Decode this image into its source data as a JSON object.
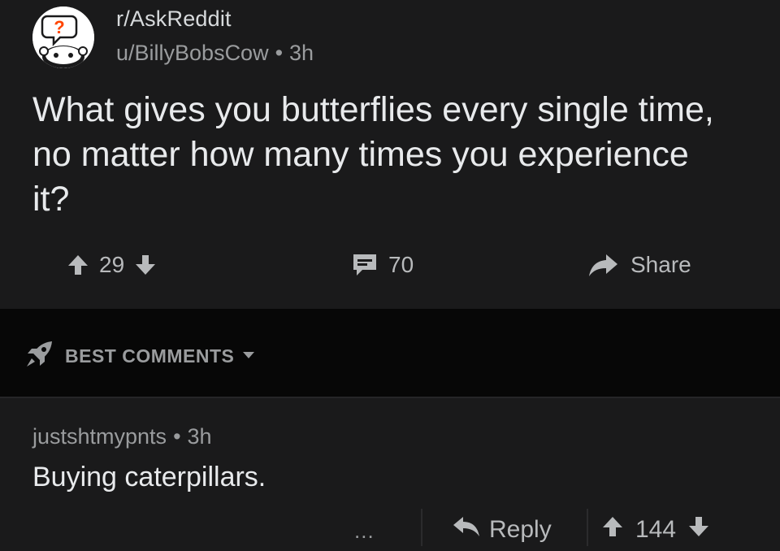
{
  "post": {
    "subreddit": "r/AskReddit",
    "author": "u/BillyBobsCow",
    "separator": "•",
    "age": "3h",
    "title": "What gives you butterflies every single time, no matter how many times you experience it?",
    "score": "29",
    "comment_count": "70",
    "share_label": "Share",
    "avatar_icon": "askreddit-snoo-icon",
    "avatar_glyph": "?"
  },
  "sort": {
    "label": "BEST COMMENTS",
    "icon": "rocket-icon"
  },
  "comment": {
    "author": "justshtmypnts",
    "separator": "•",
    "age": "3h",
    "body": "Buying caterpillars.",
    "more_label": "...",
    "reply_label": "Reply",
    "score": "144"
  },
  "colors": {
    "background": "#1a1a1b",
    "sort_bar": "#070707",
    "text_primary": "#e8eaec",
    "text_secondary": "#9a9c9e",
    "avatar_accent": "#ff4500"
  }
}
